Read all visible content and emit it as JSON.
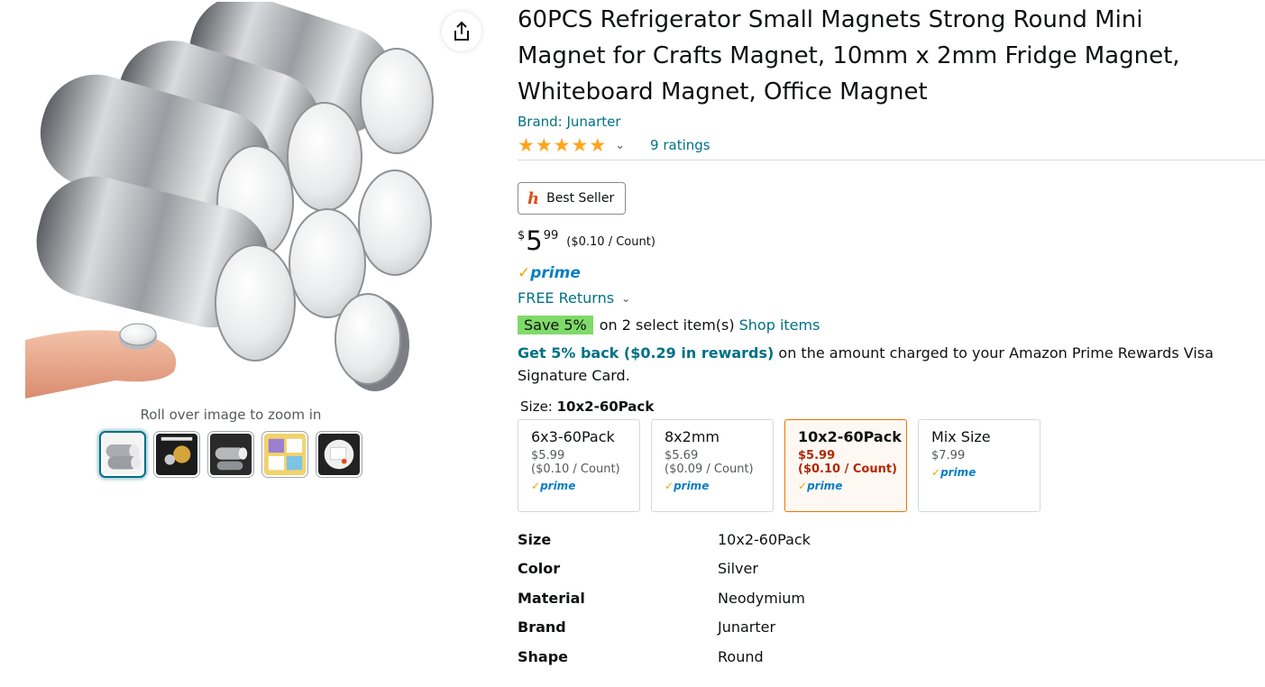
{
  "media": {
    "zoom_hint": "Roll over image to zoom in",
    "main_image": "silver-round-magnets-stack",
    "share_icon": "share-icon",
    "thumbnails": [
      {
        "name": "thumb-magnets-stack",
        "selected": true
      },
      {
        "name": "thumb-product-size",
        "selected": false
      },
      {
        "name": "thumb-strong-magnets",
        "selected": false
      },
      {
        "name": "thumb-usage-scenes",
        "selected": false
      },
      {
        "name": "thumb-whiteboard-use",
        "selected": false
      }
    ]
  },
  "product": {
    "title": "60PCS Refrigerator Small Magnets Strong Round Mini Magnet for Crafts Magnet, 10mm x 2mm Fridge Magnet, Whiteboard Magnet, Office Magnet",
    "brand_link": "Brand: Junarter",
    "rating_stars": 5,
    "ratings_text": "9 ratings",
    "badge": "Best Seller",
    "price": {
      "symbol": "$",
      "whole": "5",
      "fraction": "99",
      "unit": "($0.10 / Count)"
    },
    "prime": {
      "check": "✓",
      "text": "prime"
    },
    "returns": "FREE Returns",
    "save_badge": "Save 5%",
    "save_text": "on 2 select item(s)",
    "shop_items": "Shop items",
    "rewards_link": "Get 5% back ($0.29 in rewards)",
    "rewards_text": " on the amount charged to your Amazon Prime Rewards Visa Signature Card.",
    "size_label": "Size: ",
    "size_selected": "10x2-60Pack"
  },
  "swatches": [
    {
      "name": "6x3-60Pack",
      "price": "$5.99",
      "unit": "($0.10 / Count)",
      "prime": "prime",
      "selected": false
    },
    {
      "name": "8x2mm",
      "price": "$5.69",
      "unit": "($0.09 / Count)",
      "prime": "prime",
      "selected": false
    },
    {
      "name": "10x2-60Pack",
      "price": "$5.99",
      "unit": "($0.10 / Count)",
      "prime": "prime",
      "selected": true
    },
    {
      "name": "Mix Size",
      "price": "$7.99",
      "unit": "",
      "prime": "prime",
      "selected": false
    }
  ],
  "specs": [
    {
      "key": "Size",
      "value": "10x2-60Pack"
    },
    {
      "key": "Color",
      "value": "Silver"
    },
    {
      "key": "Material",
      "value": "Neodymium"
    },
    {
      "key": "Brand",
      "value": "Junarter"
    },
    {
      "key": "Shape",
      "value": "Round"
    }
  ],
  "colors": {
    "link": "#007185",
    "star": "#ffa41c",
    "save_badge": "#7fda69",
    "selected_border": "#e77600",
    "deal_price": "#b12704",
    "prime_blue": "#0a7ec2",
    "prime_check": "#f7a300"
  }
}
